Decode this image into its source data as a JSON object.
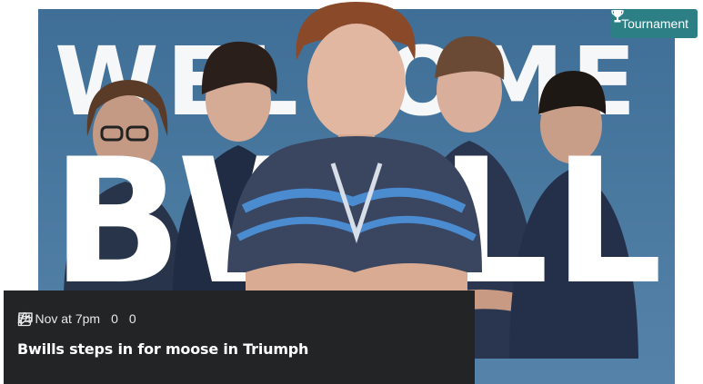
{
  "hero": {
    "welcome_text": "WELCOME",
    "player_text": "BWILLS"
  },
  "badge": {
    "label": "Tournament",
    "icon": "trophy-icon",
    "color": "#2d7f86"
  },
  "article": {
    "date": "24 Nov at 7pm",
    "comments_count": "0",
    "likes_count": "0",
    "comments_icon": "comment-icon",
    "likes_icon": "thumbs-up-icon",
    "headline": "Bwills steps in for moose in Triumph"
  }
}
